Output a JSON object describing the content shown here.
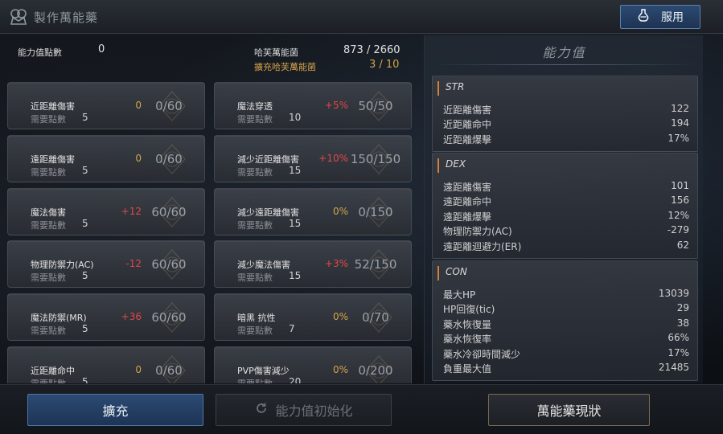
{
  "window": {
    "title": "製作萬能藥",
    "use_button": "服用"
  },
  "header": {
    "points_label": "能力值點數",
    "points_value": "0",
    "potion_label": "哈芙萬能菌",
    "potion_value": "873 / 2660",
    "extend_label": "擴充哈芙萬能菌",
    "extend_value": "3 / 10"
  },
  "need_label": "需要點數",
  "cards": [
    {
      "name": "近距離傷害",
      "bonus": "0",
      "ratio": "0/60",
      "need": "5"
    },
    {
      "name": "魔法穿透",
      "bonus": "+5%",
      "ratio": "50/50",
      "need": "10"
    },
    {
      "name": "遠距離傷害",
      "bonus": "0",
      "ratio": "0/60",
      "need": "5"
    },
    {
      "name": "減少近距離傷害",
      "bonus": "+10%",
      "ratio": "150/150",
      "need": "15"
    },
    {
      "name": "魔法傷害",
      "bonus": "+12",
      "ratio": "60/60",
      "need": "5"
    },
    {
      "name": "減少遠距離傷害",
      "bonus": "0%",
      "ratio": "0/150",
      "need": "15"
    },
    {
      "name": "物理防禦力(AC)",
      "bonus": "-12",
      "ratio": "60/60",
      "need": "5"
    },
    {
      "name": "減少魔法傷害",
      "bonus": "+3%",
      "ratio": "52/150",
      "need": "15"
    },
    {
      "name": "魔法防禦(MR)",
      "bonus": "+36",
      "ratio": "60/60",
      "need": "5"
    },
    {
      "name": "暗黑 抗性",
      "bonus": "0%",
      "ratio": "0/70",
      "need": "7"
    },
    {
      "name": "近距離命中",
      "bonus": "0",
      "ratio": "0/60",
      "need": "5"
    },
    {
      "name": "PVP傷害減少",
      "bonus": "0%",
      "ratio": "0/200",
      "need": "20"
    }
  ],
  "stats_panel": {
    "title": "能力值",
    "sections": [
      {
        "head": "STR",
        "rows": [
          {
            "label": "近距離傷害",
            "value": "122"
          },
          {
            "label": "近距離命中",
            "value": "194"
          },
          {
            "label": "近距離爆擊",
            "value": "17%"
          }
        ]
      },
      {
        "head": "DEX",
        "rows": [
          {
            "label": "遠距離傷害",
            "value": "101"
          },
          {
            "label": "遠距離命中",
            "value": "156"
          },
          {
            "label": "遠距離爆擊",
            "value": "12%"
          },
          {
            "label": "物理防禦力(AC)",
            "value": "-279"
          },
          {
            "label": "遠距離迴避力(ER)",
            "value": "62"
          }
        ]
      },
      {
        "head": "CON",
        "rows": [
          {
            "label": "最大HP",
            "value": "13039"
          },
          {
            "label": "HP回復(tic)",
            "value": "29"
          },
          {
            "label": "藥水恢復量",
            "value": "38"
          },
          {
            "label": "藥水恢復率",
            "value": "66%"
          },
          {
            "label": "藥水冷卻時間減少",
            "value": "17%"
          },
          {
            "label": "負重最大值",
            "value": "21485"
          }
        ]
      }
    ]
  },
  "bottom": {
    "expand": "擴充",
    "reset": "能力值初始化",
    "status": "萬能藥現狀"
  },
  "colors": {
    "accent_blue": "#2b4a73",
    "gold": "#d4a34a",
    "red": "#e04848"
  }
}
